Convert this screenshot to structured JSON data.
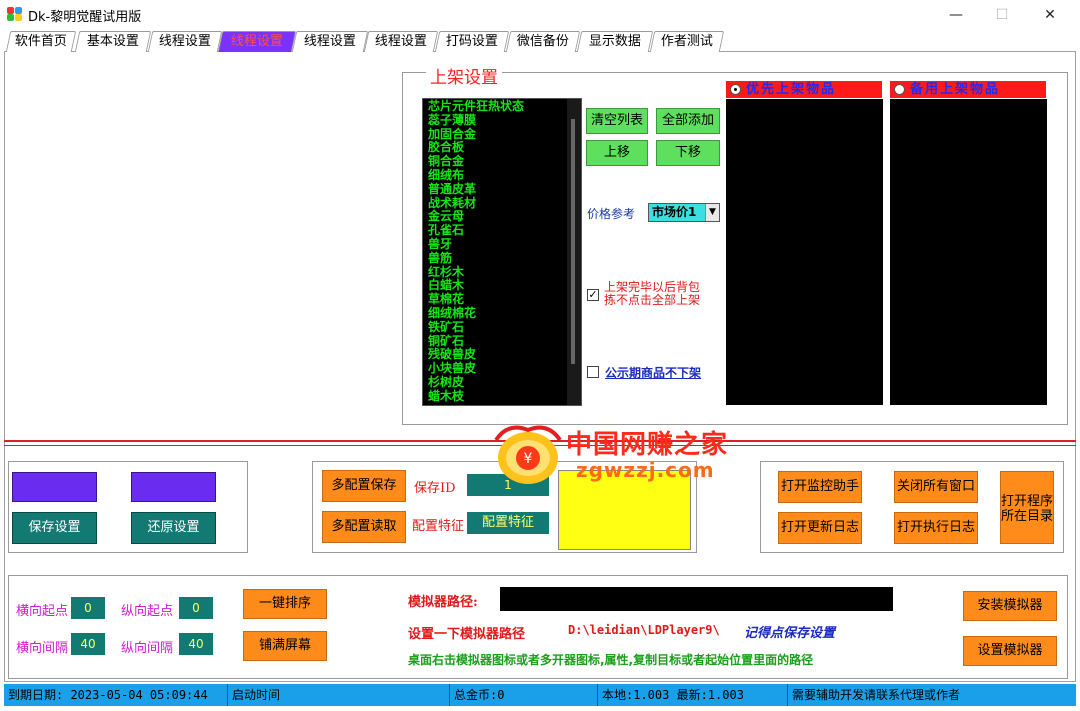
{
  "window": {
    "title": "Dk-黎明觉醒试用版",
    "minimize": "—",
    "maximize": "☐",
    "close": "✕"
  },
  "tabs": [
    {
      "label": "软件首页"
    },
    {
      "label": "基本设置"
    },
    {
      "label": "线程设置"
    },
    {
      "label": "线程设置"
    },
    {
      "label": "线程设置"
    },
    {
      "label": "线程设置"
    },
    {
      "label": "打码设置"
    },
    {
      "label": "微信备份"
    },
    {
      "label": "显示数据"
    },
    {
      "label": "作者测试"
    }
  ],
  "shelf": {
    "title": "上架设置",
    "items": [
      "芯片元件狂热状态",
      "蕊子薄膜",
      "加固合金",
      "胶合板",
      "铜合金",
      "细绒布",
      "普通皮革",
      "战术耗材",
      "金云母",
      "孔雀石",
      "兽牙",
      "兽筋",
      "红杉木",
      "白蜡木",
      "草棉花",
      "细绒棉花",
      "铁矿石",
      "铜矿石",
      "残破兽皮",
      "小块兽皮",
      "杉树皮",
      "蜡木枝"
    ],
    "clear_list": "清空列表",
    "add_all": "全部添加",
    "move_up": "上移",
    "move_down": "下移",
    "price_ref_label": "价格参考",
    "price_ref_value": "市场价1",
    "auto_shelf_line1": "上架完毕以后背包",
    "auto_shelf_line2": "拣不点击全部上架",
    "no_unshelf_label": "公示期商品不下架",
    "priority_header": "优先上架物品",
    "backup_header": "备用上架物品"
  },
  "config": {
    "left_btn1": "保存设置",
    "left_btn2": "还原设置",
    "multi_save": "多配置保存",
    "multi_load": "多配置读取",
    "save_id_label": "保存ID",
    "save_id_value": "1",
    "feature_label": "配置特征",
    "feature_value": "配置特征",
    "open_monitor": "打开监控助手",
    "close_windows": "关闭所有窗口",
    "open_program_dir_1": "打开程序",
    "open_program_dir_2": "所在目录",
    "open_update_log": "打开更新日志",
    "open_exec_log": "打开执行日志"
  },
  "emulator": {
    "h_start_label": "横向起点",
    "h_start_value": "0",
    "v_start_label": "纵向起点",
    "v_start_value": "0",
    "h_gap_label": "横向间隔",
    "h_gap_value": "40",
    "v_gap_label": "纵向间隔",
    "v_gap_value": "40",
    "one_click_sort": "一键排序",
    "fill_screen": "铺满屏幕",
    "path_label": "模拟器路径:",
    "set_path_hint": "设置一下模拟器路径",
    "example_path": "D:\\leidian\\LDPlayer9\\",
    "remember_hint": "记得点保存设置",
    "desktop_hint": "桌面右击模拟器图标或者多开器图标,属性,复制目标或者起始位置里面的路径",
    "install_emulator": "安装模拟器",
    "set_emulator": "设置模拟器"
  },
  "status": {
    "expiry": "到期日期: 2023-05-04 05:09:44",
    "start_time": "启动时间",
    "total_gold": "总金币:0",
    "version": "本地:1.003   最新:1.003",
    "contact": "需要辅助开发请联系代理或作者"
  },
  "watermark": {
    "title": "中国网赚之家",
    "url": "zgwzzj.com"
  },
  "colors": {
    "accent_tab": "#7a32ff",
    "green_button": "#5ee05e",
    "teal": "#127a72",
    "orange": "#ff8c1a",
    "status_bar": "#1aa0e8",
    "header_red": "#ff1a1a"
  }
}
